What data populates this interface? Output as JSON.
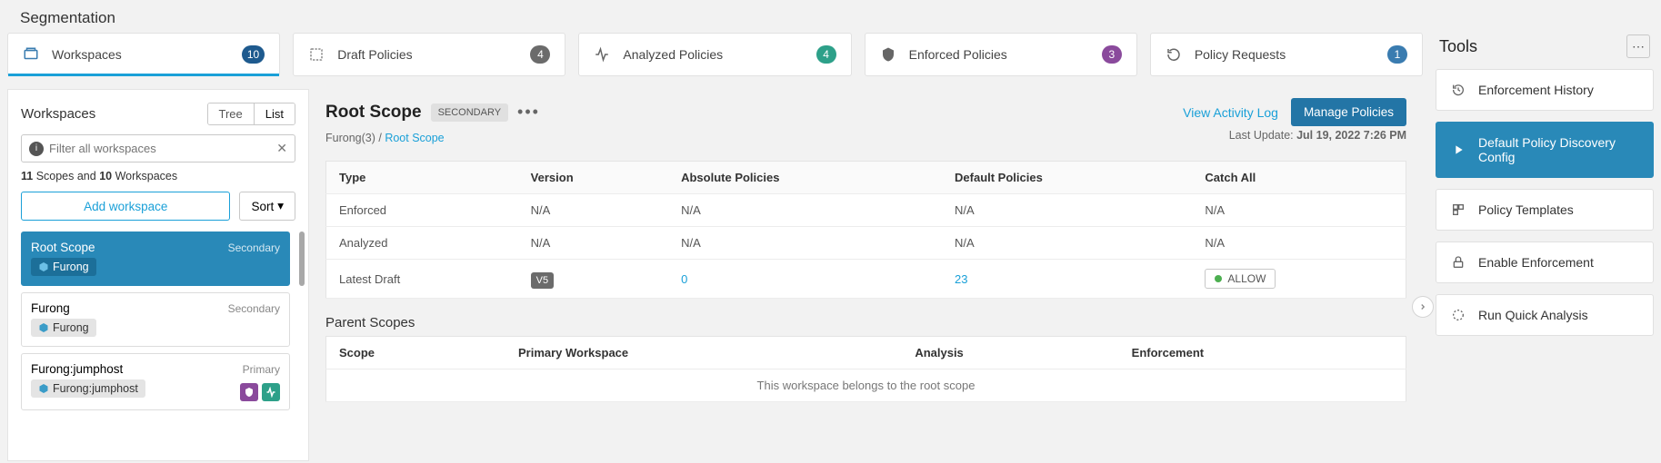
{
  "page_title": "Segmentation",
  "tabs": [
    {
      "label": "Workspaces",
      "count": "10",
      "badge_class": "badge-blue",
      "icon": "workspaces-icon"
    },
    {
      "label": "Draft Policies",
      "count": "4",
      "badge_class": "badge-grey",
      "icon": "draft-icon"
    },
    {
      "label": "Analyzed Policies",
      "count": "4",
      "badge_class": "badge-teal",
      "icon": "analyzed-icon"
    },
    {
      "label": "Enforced Policies",
      "count": "3",
      "badge_class": "badge-purple",
      "icon": "enforced-icon"
    },
    {
      "label": "Policy Requests",
      "count": "1",
      "badge_class": "badge-lightblue",
      "icon": "requests-icon"
    }
  ],
  "left": {
    "title": "Workspaces",
    "toggle": {
      "tree": "Tree",
      "list": "List"
    },
    "filter_placeholder": "Filter all workspaces",
    "summary_prefix": "11",
    "summary_mid": " Scopes and ",
    "summary_wscount": "10",
    "summary_suffix": " Workspaces",
    "add_btn": "Add workspace",
    "sort_btn": "Sort",
    "cards": [
      {
        "name": "Root Scope",
        "tag": "Secondary",
        "chip": "Furong",
        "selected": true
      },
      {
        "name": "Furong",
        "tag": "Secondary",
        "chip": "Furong",
        "selected": false
      },
      {
        "name": "Furong:jumphost",
        "tag": "Primary",
        "chip": "Furong:jumphost",
        "selected": false,
        "badges": true
      }
    ]
  },
  "right": {
    "title": "Root Scope",
    "chip": "SECONDARY",
    "breadcrumb_left": "Furong(3)",
    "breadcrumb_sep": " / ",
    "breadcrumb_link": "Root Scope",
    "last_update_label": "Last Update: ",
    "last_update_val": "Jul 19, 2022 7:26 PM",
    "view_log": "View Activity Log",
    "manage": "Manage Policies",
    "table_headers": {
      "type": "Type",
      "version": "Version",
      "abs": "Absolute Policies",
      "def": "Default Policies",
      "catch": "Catch All"
    },
    "rows": [
      {
        "type": "Enforced",
        "version": "N/A",
        "abs": "N/A",
        "def": "N/A",
        "catch": "N/A"
      },
      {
        "type": "Analyzed",
        "version": "N/A",
        "abs": "N/A",
        "def": "N/A",
        "catch": "N/A"
      },
      {
        "type": "Latest Draft",
        "version": "V5",
        "abs": "0",
        "def": "23",
        "catch": "ALLOW"
      }
    ],
    "parent_title": "Parent Scopes",
    "scope_headers": {
      "scope": "Scope",
      "primary": "Primary Workspace",
      "analysis": "Analysis",
      "enf": "Enforcement"
    },
    "scope_msg": "This workspace belongs to the root scope"
  },
  "tools": {
    "title": "Tools",
    "items": [
      {
        "label": "Enforcement History",
        "icon": "history-icon"
      },
      {
        "label": "Default Policy Discovery Config",
        "icon": "play-icon",
        "active": true
      },
      {
        "label": "Policy Templates",
        "icon": "templates-icon"
      },
      {
        "label": "Enable Enforcement",
        "icon": "lock-icon"
      },
      {
        "label": "Run Quick Analysis",
        "icon": "loader-icon"
      }
    ]
  }
}
